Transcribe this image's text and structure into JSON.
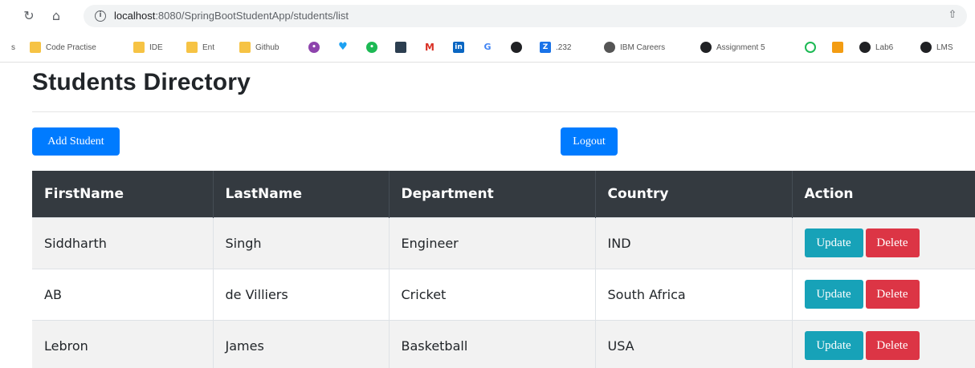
{
  "browser": {
    "url_host": "localhost",
    "url_path": ":8080/SpringBootStudentApp/students/list",
    "bookmarks": [
      {
        "label": "s",
        "icon": "none"
      },
      {
        "label": "Code Practise",
        "icon": "folder-icon"
      },
      {
        "label": "IDE",
        "icon": "folder-icon"
      },
      {
        "label": "Ent",
        "icon": "folder-icon"
      },
      {
        "label": "Github",
        "icon": "folder-icon"
      },
      {
        "label": "",
        "icon": "purple-circle-icon"
      },
      {
        "label": "",
        "icon": "twitter-icon"
      },
      {
        "label": "",
        "icon": "green-circle-icon"
      },
      {
        "label": "",
        "icon": "square-dark-icon"
      },
      {
        "label": "",
        "icon": "gmail-icon"
      },
      {
        "label": "",
        "icon": "linkedin-icon"
      },
      {
        "label": "",
        "icon": "g-icon"
      },
      {
        "label": "",
        "icon": "github-icon"
      },
      {
        "label": ".232",
        "icon": "blue-square-icon"
      },
      {
        "label": "IBM Careers",
        "icon": "globe-icon"
      },
      {
        "label": "Assignment 5",
        "icon": "github-icon"
      },
      {
        "label": "",
        "icon": "green-ring-icon"
      },
      {
        "label": "",
        "icon": "orange-square-icon"
      },
      {
        "label": "Lab6",
        "icon": "github-icon"
      },
      {
        "label": "LMS",
        "icon": "github-icon"
      }
    ]
  },
  "page": {
    "title": "Students Directory",
    "add_label": "Add Student",
    "logout_label": "Logout"
  },
  "table": {
    "headers": [
      "FirstName",
      "LastName",
      "Department",
      "Country",
      "Action"
    ],
    "rows": [
      {
        "first": "Siddharth",
        "last": "Singh",
        "dept": "Engineer",
        "country": "IND"
      },
      {
        "first": "AB",
        "last": "de Villiers",
        "dept": "Cricket",
        "country": "South Africa"
      },
      {
        "first": "Lebron",
        "last": "James",
        "dept": "Basketball",
        "country": "USA"
      }
    ],
    "update_label": "Update",
    "delete_label": "Delete"
  },
  "colors": {
    "primary": "#007bff",
    "info": "#17a2b8",
    "danger": "#dc3545",
    "table_header": "#343a40"
  }
}
